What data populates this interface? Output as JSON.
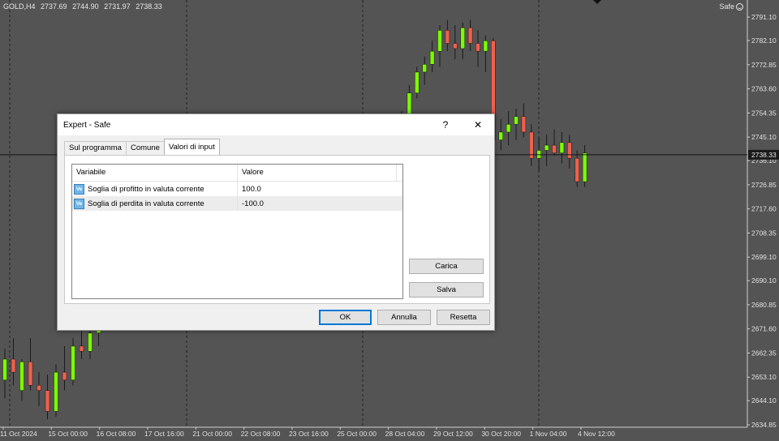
{
  "chart_header": {
    "ohlc": [
      "GOLD,H4",
      "2737.69",
      "2744.90",
      "2731.97",
      "2738.33"
    ],
    "expert_label": "Safe",
    "expert_icon": "smiley-icon"
  },
  "chart_data": {
    "type": "candlestick",
    "y_ticks": [
      "2791.10",
      "2782.10",
      "2772.85",
      "2763.60",
      "2754.35",
      "2745.10",
      "2736.10",
      "2726.85",
      "2717.60",
      "2708.35",
      "2699.10",
      "2690.10",
      "2680.85",
      "2671.60",
      "2662.35",
      "2653.10",
      "2644.10",
      "2634.85"
    ],
    "ylim": [
      2634.85,
      2791.1
    ],
    "x_ticks": [
      "11 Oct 2024",
      "15 Oct 00:00",
      "16 Oct 08:00",
      "17 Oct 16:00",
      "21 Oct 00:00",
      "22 Oct 08:00",
      "23 Oct 16:00",
      "25 Oct 00:00",
      "28 Oct 04:00",
      "29 Oct 12:00",
      "30 Oct 20:00",
      "1 Nov 04:00",
      "4 Nov 12:00"
    ],
    "current_price": "2738.33",
    "grid": true,
    "colors": {
      "bull": "#7cfc00",
      "bear": "#f0604c",
      "background": "#545454"
    },
    "candles": [
      {
        "o": 2652,
        "h": 2664,
        "l": 2645,
        "c": 2660
      },
      {
        "o": 2660,
        "h": 2668,
        "l": 2650,
        "c": 2655
      },
      {
        "o": 2648,
        "h": 2660,
        "l": 2644,
        "c": 2659
      },
      {
        "o": 2659,
        "h": 2668,
        "l": 2648,
        "c": 2650
      },
      {
        "o": 2650,
        "h": 2655,
        "l": 2642,
        "c": 2648
      },
      {
        "o": 2648,
        "h": 2654,
        "l": 2637,
        "c": 2640
      },
      {
        "o": 2640,
        "h": 2658,
        "l": 2638,
        "c": 2655
      },
      {
        "o": 2655,
        "h": 2665,
        "l": 2648,
        "c": 2652
      },
      {
        "o": 2652,
        "h": 2668,
        "l": 2650,
        "c": 2665
      },
      {
        "o": 2665,
        "h": 2672,
        "l": 2660,
        "c": 2663
      },
      {
        "o": 2663,
        "h": 2674,
        "l": 2660,
        "c": 2670
      },
      {
        "o": 2670,
        "h": 2675,
        "l": 2665,
        "c": 2672
      },
      {
        "o": 2745,
        "h": 2755,
        "l": 2740,
        "c": 2752
      },
      {
        "o": 2752,
        "h": 2765,
        "l": 2750,
        "c": 2762
      },
      {
        "o": 2762,
        "h": 2772,
        "l": 2760,
        "c": 2770
      },
      {
        "o": 2770,
        "h": 2776,
        "l": 2765,
        "c": 2773
      },
      {
        "o": 2773,
        "h": 2782,
        "l": 2770,
        "c": 2778
      },
      {
        "o": 2778,
        "h": 2788,
        "l": 2772,
        "c": 2786
      },
      {
        "o": 2786,
        "h": 2790,
        "l": 2778,
        "c": 2781
      },
      {
        "o": 2781,
        "h": 2788,
        "l": 2775,
        "c": 2779
      },
      {
        "o": 2779,
        "h": 2789,
        "l": 2775,
        "c": 2787
      },
      {
        "o": 2787,
        "h": 2790,
        "l": 2778,
        "c": 2781
      },
      {
        "o": 2781,
        "h": 2786,
        "l": 2772,
        "c": 2778
      },
      {
        "o": 2778,
        "h": 2784,
        "l": 2770,
        "c": 2782
      },
      {
        "o": 2782,
        "h": 2783,
        "l": 2740,
        "c": 2744
      },
      {
        "o": 2744,
        "h": 2752,
        "l": 2740,
        "c": 2747
      },
      {
        "o": 2747,
        "h": 2755,
        "l": 2742,
        "c": 2750
      },
      {
        "o": 2750,
        "h": 2756,
        "l": 2744,
        "c": 2753
      },
      {
        "o": 2753,
        "h": 2758,
        "l": 2745,
        "c": 2747
      },
      {
        "o": 2747,
        "h": 2750,
        "l": 2734,
        "c": 2737
      },
      {
        "o": 2737,
        "h": 2745,
        "l": 2732,
        "c": 2740
      },
      {
        "o": 2740,
        "h": 2746,
        "l": 2734,
        "c": 2742
      },
      {
        "o": 2742,
        "h": 2748,
        "l": 2738,
        "c": 2739
      },
      {
        "o": 2739,
        "h": 2747,
        "l": 2735,
        "c": 2743
      },
      {
        "o": 2743,
        "h": 2746,
        "l": 2733,
        "c": 2737
      },
      {
        "o": 2737,
        "h": 2740,
        "l": 2726,
        "c": 2728
      },
      {
        "o": 2728,
        "h": 2742,
        "l": 2726,
        "c": 2739
      }
    ]
  },
  "dialog": {
    "title": "Expert - Safe",
    "help_label": "?",
    "close_label": "✕",
    "tabs": [
      {
        "label": "Sul programma",
        "active": false
      },
      {
        "label": "Comune",
        "active": false
      },
      {
        "label": "Valori di input",
        "active": true
      }
    ],
    "columns": [
      "Variabile",
      "Valore"
    ],
    "rows": [
      {
        "icon_text": "Ve",
        "variable": "Soglia di profitto in valuta corrente",
        "value": "100.0"
      },
      {
        "icon_text": "Ve",
        "variable": "Soglia di perdita in valuta corrente",
        "value": "-100.0"
      }
    ],
    "load_label": "Carica",
    "save_label": "Salva",
    "ok_label": "OK",
    "cancel_label": "Annulla",
    "reset_label": "Resetta"
  }
}
